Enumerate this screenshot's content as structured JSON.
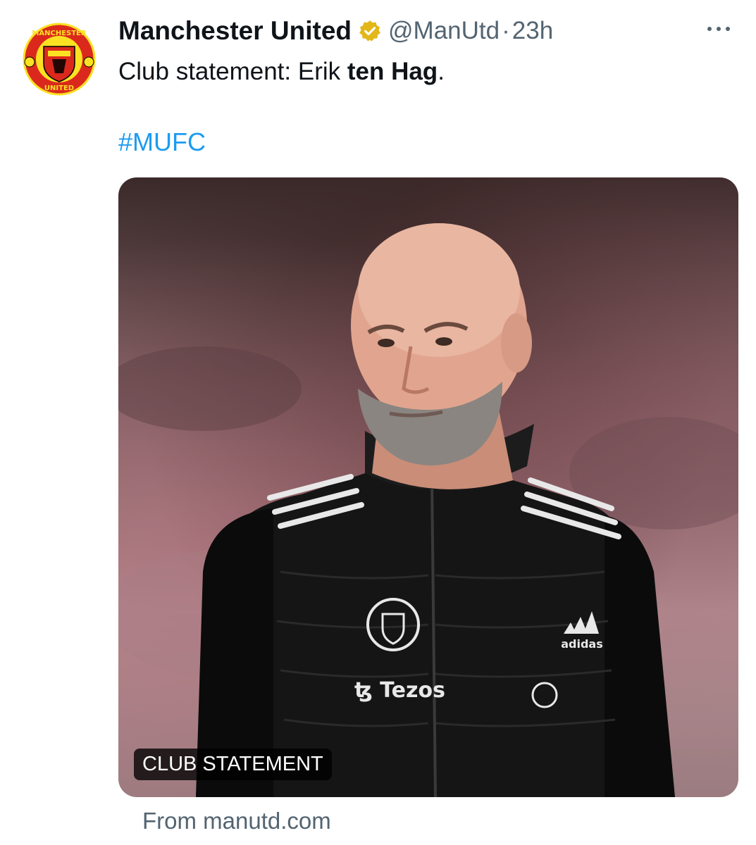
{
  "tweet": {
    "display_name": "Manchester United",
    "handle": "@ManUtd",
    "separator": "·",
    "time": "23h",
    "text_plain": "Club statement: Erik ",
    "text_bold": "ten Hag",
    "text_end": ".",
    "hashtag": "#MUFC"
  },
  "media": {
    "label": "CLUB STATEMENT",
    "source": "From manutd.com"
  },
  "icons": {
    "avatar": "manchester-united-crest",
    "verified": "gold-verified-badge",
    "more": "more-dots-icon"
  },
  "colors": {
    "link": "#1d9bf0",
    "secondary_text": "#536471",
    "verified_gold": "#e2b719",
    "crest_red": "#da291c",
    "crest_yellow": "#fbe122"
  }
}
